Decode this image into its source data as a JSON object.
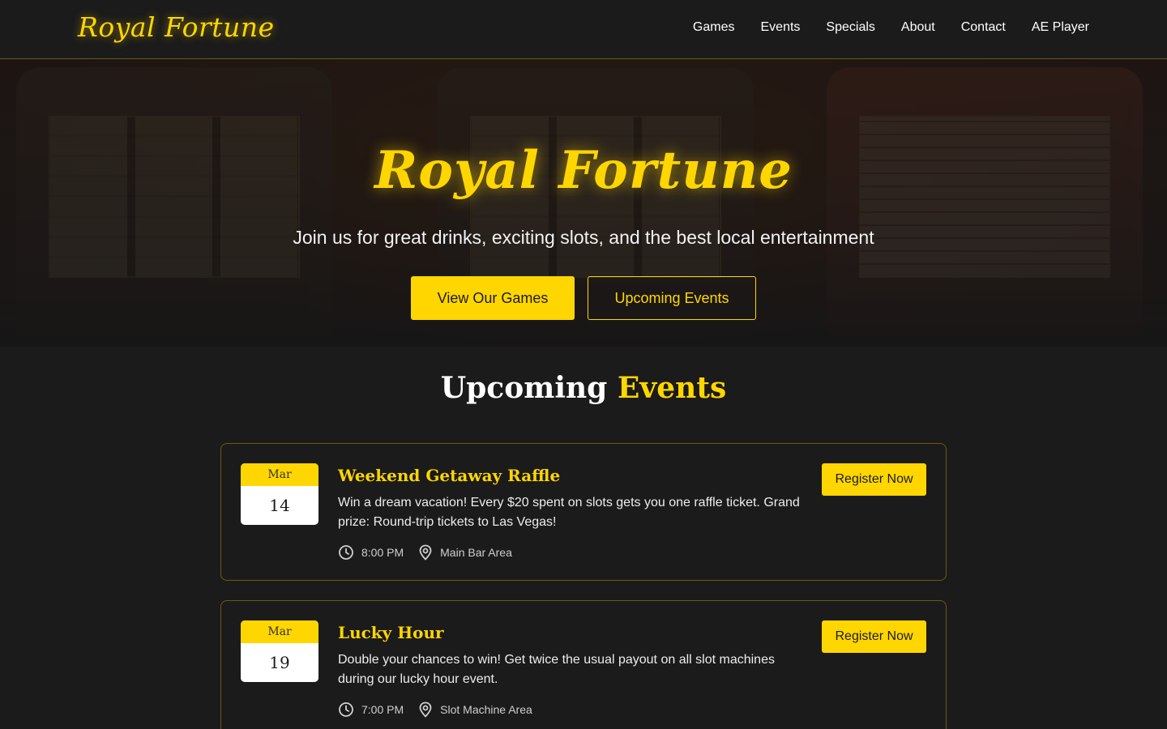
{
  "header": {
    "logo": "Royal Fortune",
    "nav": [
      "Games",
      "Events",
      "Specials",
      "About",
      "Contact",
      "AE Player"
    ]
  },
  "hero": {
    "title": "Royal Fortune",
    "subtitle": "Join us for great drinks, exciting slots, and the best local entertainment",
    "primary_button": "View Our Games",
    "secondary_button": "Upcoming Events"
  },
  "events_section": {
    "title_main": "Upcoming",
    "title_accent": "Events",
    "events": [
      {
        "month": "Mar",
        "day": "14",
        "title": "Weekend Getaway Raffle",
        "description": "Win a dream vacation! Every $20 spent on slots gets you one raffle ticket. Grand prize: Round-trip tickets to Las Vegas!",
        "time": "8:00 PM",
        "location": "Main Bar Area",
        "button": "Register Now"
      },
      {
        "month": "Mar",
        "day": "19",
        "title": "Lucky Hour",
        "description": "Double your chances to win! Get twice the usual payout on all slot machines during our lucky hour event.",
        "time": "7:00 PM",
        "location": "Slot Machine Area",
        "button": "Register Now"
      }
    ]
  },
  "colors": {
    "accent": "#ffd600",
    "background": "#1b1b1b",
    "card_border": "#6b5a12"
  },
  "icons": [
    "clock-icon",
    "location-pin-icon"
  ]
}
